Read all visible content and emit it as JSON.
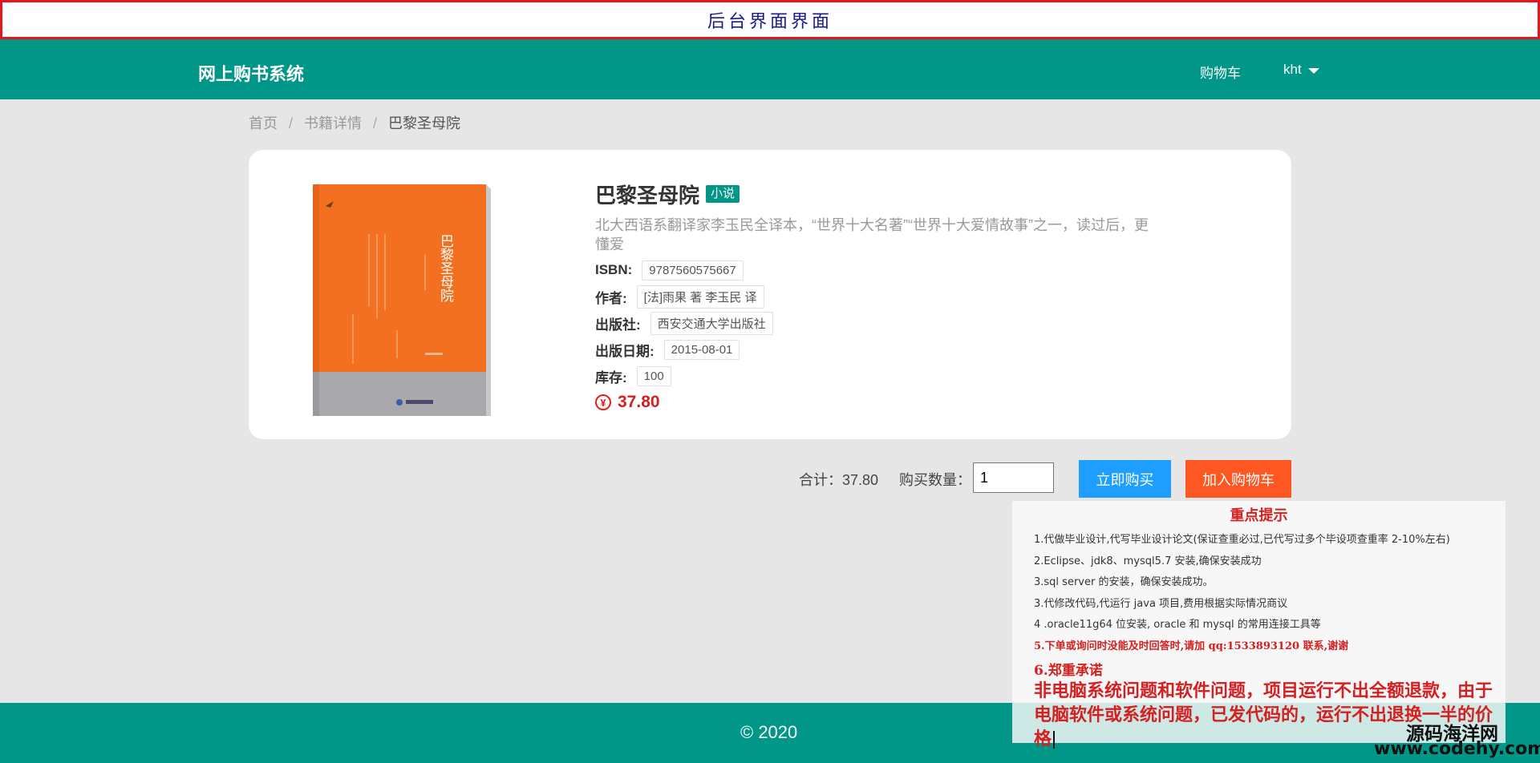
{
  "banner": {
    "text": "后台界面界面"
  },
  "navbar": {
    "brand": "网上购书系统",
    "cart": "购物车",
    "user": "kht"
  },
  "breadcrumb": {
    "home": "首页",
    "details": "书籍详情",
    "current": "巴黎圣母院"
  },
  "book": {
    "title": "巴黎圣母院",
    "tag": "小说",
    "description": "北大西语系翻译家李玉民全译本，“世界十大名著”“世界十大爱情故事”之一，读过后，更懂爱",
    "fields": [
      {
        "label": "ISBN:",
        "value": "9787560575667"
      },
      {
        "label": "作者:",
        "value": "[法]雨果 著 李玉民 译"
      },
      {
        "label": "出版社:",
        "value": "西安交通大学出版社"
      },
      {
        "label": "出版日期:",
        "value": "2015-08-01"
      },
      {
        "label": "库存:",
        "value": "100"
      }
    ],
    "price": "37.80",
    "cover": {
      "title": "巴黎圣母院",
      "color": "#f37021",
      "bottom_color": "#a9a9ad"
    }
  },
  "purchase": {
    "total": "合计：37.80",
    "qty_label": "购买数量：",
    "qty_value": "1",
    "buy_label": "立即购买",
    "cart_label": "加入购物车"
  },
  "footer": {
    "text": "© 2020"
  },
  "notice": {
    "title": "重点提示",
    "lines": [
      "1.代做毕业设计,代写毕业设计论文(保证查重必过,已代写过多个毕设项查重率 2-10%左右)",
      "2.Eclipse、jdk8、mysql5.7 安装,确保安装成功",
      "3.sql server 的安装，确保安装成功。",
      "3.代修改代码,代运行 java 项目,费用根据实际情况商议",
      "4 .oracle11g64 位安装, oracle 和 mysql 的常用连接工具等"
    ],
    "line5": "5.下单或询问时没能及时回答时,请加 qq:1533893120 联系,谢谢",
    "line6": "6.郑重承诺",
    "big_text": "非电脑系统问题和软件问题，项目运行不出全额退款，由于电脑软件或系统问题，已发代码的，运行不出退换一半的价格"
  },
  "watermark": {
    "line1": "源码海洋网",
    "line2": "www.codehy.com"
  },
  "colors": {
    "primary": "#009688",
    "buy": "#1e9fff",
    "cart": "#ff5722",
    "price": "#d42020"
  }
}
